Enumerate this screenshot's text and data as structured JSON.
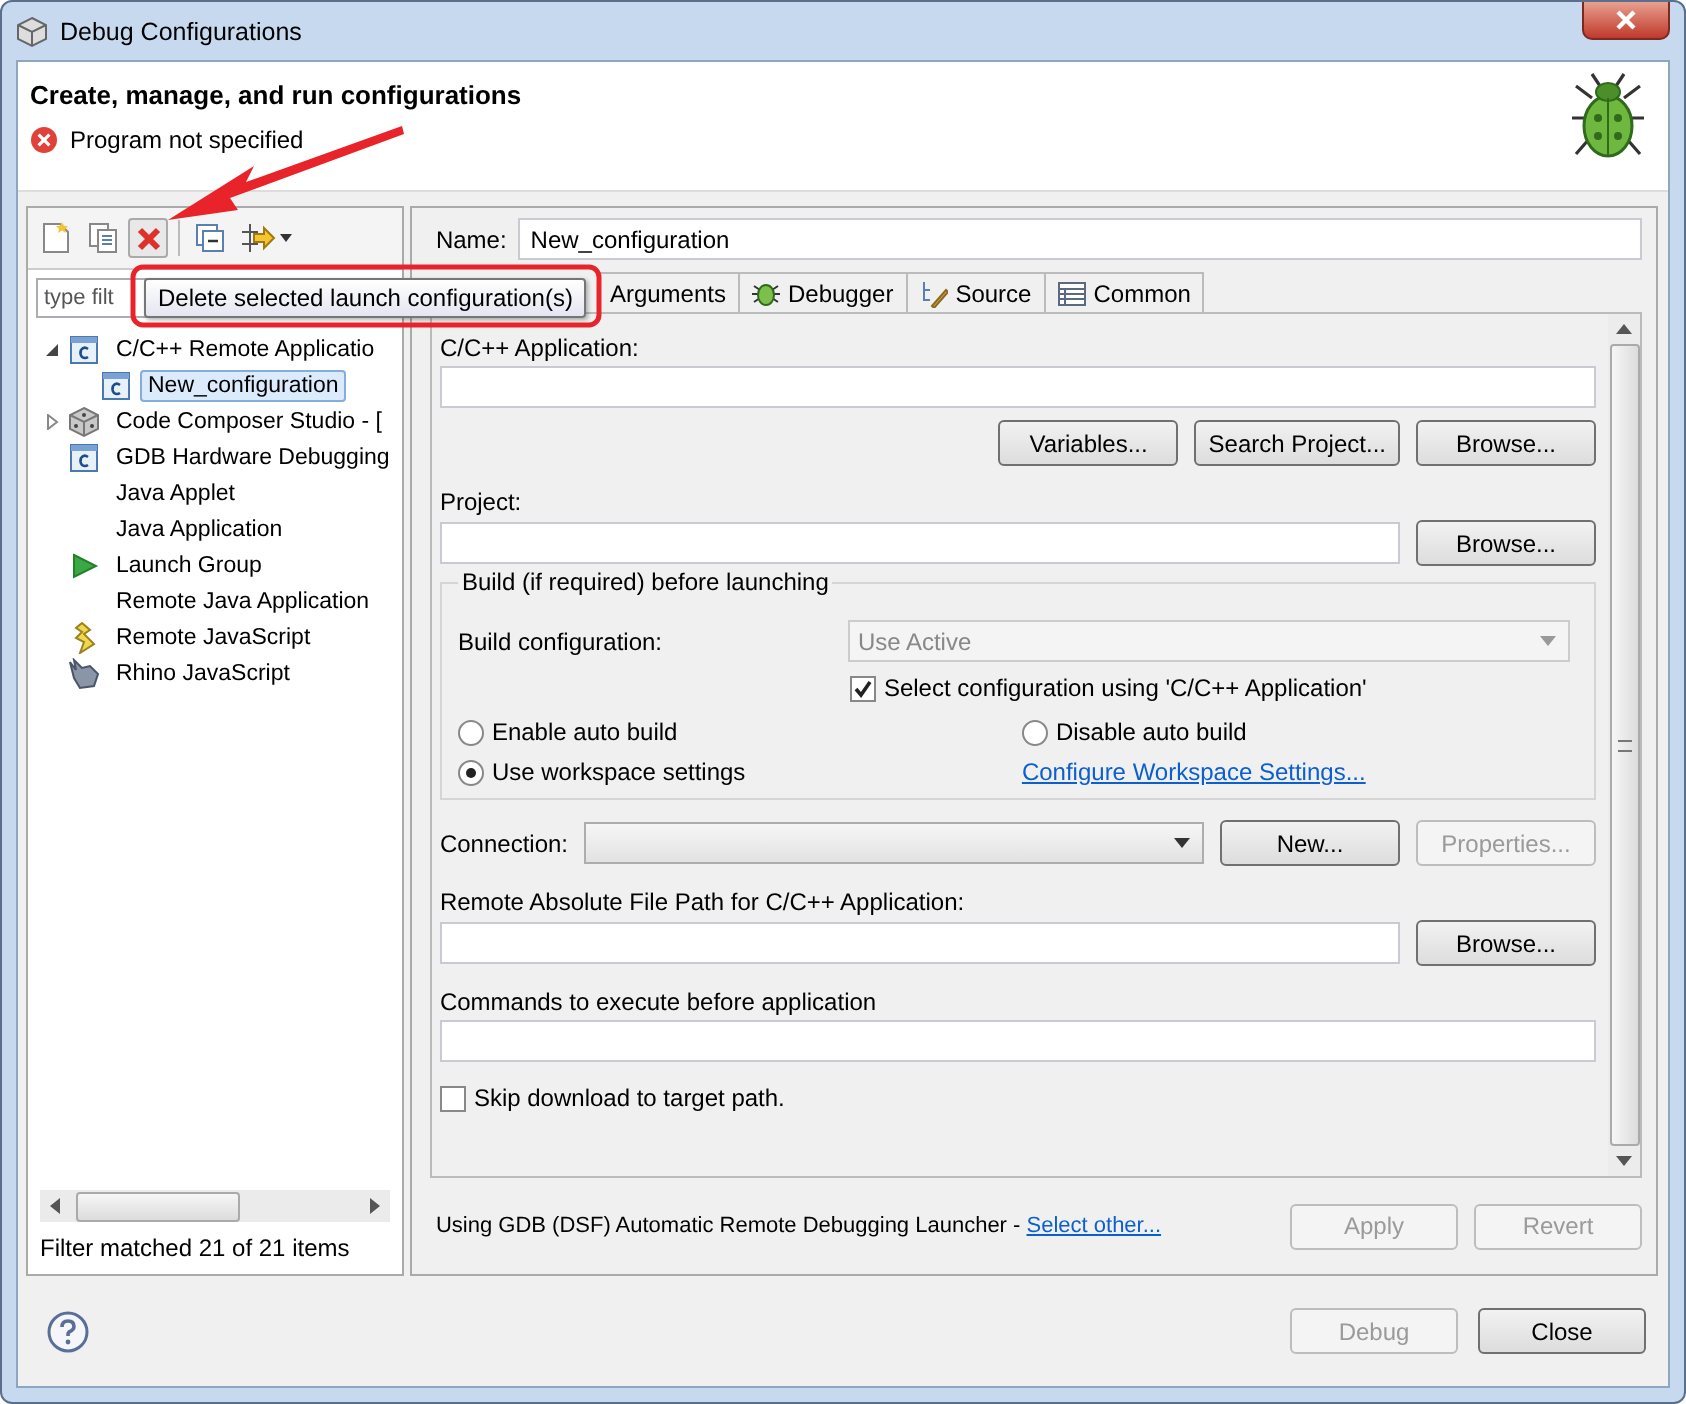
{
  "window": {
    "title": "Debug Configurations"
  },
  "header": {
    "title": "Create, manage, and run configurations",
    "message": "Program not specified"
  },
  "filter": {
    "placeholder": "type filt"
  },
  "tooltip": {
    "text": "Delete selected launch configuration(s)"
  },
  "tree": [
    {
      "label": "C/C++ Remote Applicatio",
      "kind": "c",
      "expanded": true,
      "selected": false,
      "children": [
        {
          "label": "New_configuration",
          "kind": "c",
          "selected": true
        }
      ]
    },
    {
      "label": "Code Composer Studio - [",
      "kind": "dice",
      "expanded": false,
      "selected": false
    },
    {
      "label": "GDB Hardware Debugging",
      "kind": "c",
      "selected": false
    },
    {
      "label": "Java Applet",
      "kind": "none",
      "selected": false
    },
    {
      "label": "Java Application",
      "kind": "none",
      "selected": false
    },
    {
      "label": "Launch Group",
      "kind": "play",
      "selected": false
    },
    {
      "label": "Remote Java Application",
      "kind": "none",
      "selected": false
    },
    {
      "label": "Remote JavaScript",
      "kind": "bolt",
      "selected": false
    },
    {
      "label": "Rhino JavaScript",
      "kind": "rhino",
      "selected": false
    }
  ],
  "filter_status": "Filter matched 21 of 21 items",
  "name": {
    "label": "Name:",
    "value": "New_configuration"
  },
  "tabs": [
    {
      "label": "Arguments",
      "kind": "none",
      "selected": false
    },
    {
      "label": "Debugger",
      "kind": "bug",
      "selected": false
    },
    {
      "label": "Source",
      "kind": "source",
      "selected": false
    },
    {
      "label": "Common",
      "kind": "common",
      "selected": false
    }
  ],
  "application": {
    "label": "C/C++ Application:",
    "buttons": [
      {
        "label": "Variables...",
        "disabled": false
      },
      {
        "label": "Search Project...",
        "disabled": false
      },
      {
        "label": "Browse...",
        "disabled": false
      }
    ]
  },
  "project": {
    "label": "Project:",
    "button": {
      "label": "Browse...",
      "disabled": false
    }
  },
  "build": {
    "title": "Build (if required) before launching",
    "config_label": "Build configuration:",
    "config_value": "Use Active",
    "config_disabled": true,
    "select_config": {
      "label": "Select configuration using 'C/C++ Application'",
      "checked": true
    },
    "radios": [
      {
        "label": "Enable auto build",
        "selected": false
      },
      {
        "label": "Disable auto build",
        "selected": false
      },
      {
        "label": "Use workspace settings",
        "selected": true
      }
    ],
    "link": "Configure Workspace Settings..."
  },
  "connection": {
    "label": "Connection:",
    "buttons": [
      {
        "label": "New...",
        "disabled": false
      },
      {
        "label": "Properties...",
        "disabled": true
      }
    ]
  },
  "remote_path": {
    "label": "Remote Absolute File Path for C/C++ Application:",
    "button": {
      "label": "Browse...",
      "disabled": false
    }
  },
  "commands": {
    "label": "Commands to execute before application"
  },
  "skip_download": {
    "label": "Skip download to target path.",
    "checked": false
  },
  "launcher": {
    "text": "Using GDB (DSF) Automatic Remote Debugging Launcher - ",
    "link": "Select other...",
    "buttons": [
      {
        "label": "Apply",
        "disabled": true
      },
      {
        "label": "Revert",
        "disabled": true
      }
    ]
  },
  "dialog_buttons": [
    {
      "label": "Debug",
      "disabled": true
    },
    {
      "label": "Close",
      "disabled": false
    }
  ]
}
